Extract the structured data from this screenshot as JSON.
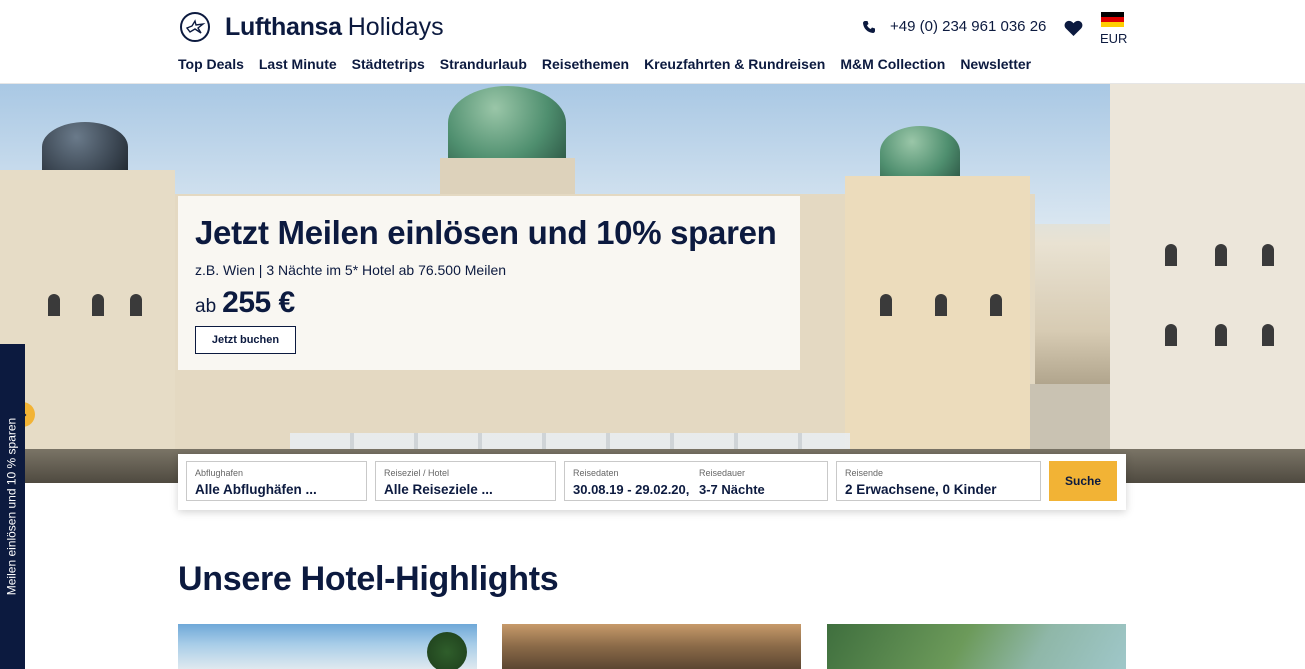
{
  "header": {
    "brand": "Lufthansa",
    "brand_sub": "Holidays",
    "phone": "+49 (0) 234 961 036 26",
    "currency": "EUR",
    "nav": [
      "Top Deals",
      "Last Minute",
      "Städtetrips",
      "Strandurlaub",
      "Reisethemen",
      "Kreuzfahrten & Rundreisen",
      "M&M Collection",
      "Newsletter"
    ]
  },
  "hero": {
    "title": "Jetzt Meilen einlösen und 10% sparen",
    "subtitle": "z.B. Wien | 3 Nächte im 5* Hotel ab 76.500 Meilen",
    "price_prefix": "ab",
    "price": "255 €",
    "button": "Jetzt buchen",
    "slides_total": 3,
    "slide_active": 3
  },
  "side_tab": {
    "label": "Meilen einlösen und 10 % sparen"
  },
  "search": {
    "departure": {
      "label": "Abflughafen",
      "value": "Alle Abflughäfen ..."
    },
    "destination": {
      "label": "Reiseziel / Hotel",
      "value": "Alle Reiseziele ..."
    },
    "dates": {
      "label": "Reisedaten",
      "value": "30.08.19 - 29.02.20,"
    },
    "duration": {
      "label": "Reisedauer",
      "value": "3-7 Nächte"
    },
    "travellers": {
      "label": "Reisende",
      "value": "2 Erwachsene, 0 Kinder"
    },
    "button": "Suche"
  },
  "highlights": {
    "title": "Unsere Hotel-Highlights"
  },
  "colors": {
    "navy": "#0c1a3f",
    "accent": "#f2b335"
  },
  "icons": {
    "logo": "lufthansa-crane-icon",
    "phone": "phone-icon",
    "favorites": "heart-icon",
    "flag": "germany-flag-icon",
    "slider_next": "chevron-right-icon"
  }
}
